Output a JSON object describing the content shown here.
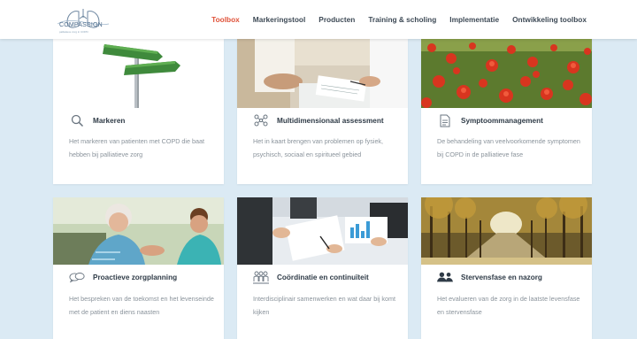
{
  "header": {
    "logo": {
      "title": "COMPASSION",
      "subtitle": "palliatieve zorg in COPD"
    },
    "nav": [
      {
        "label": "Toolbox",
        "active": true
      },
      {
        "label": "Markeringstool",
        "active": false
      },
      {
        "label": "Producten",
        "active": false
      },
      {
        "label": "Training & scholing",
        "active": false
      },
      {
        "label": "Implementatie",
        "active": false
      },
      {
        "label": "Ontwikkeling toolbox",
        "active": false
      }
    ]
  },
  "cards": [
    {
      "icon": "magnifier-icon",
      "title": "Markeren",
      "description": "Het markeren van patienten met COPD die baat hebben bij palliatieve zorg",
      "image": "signpost-image"
    },
    {
      "icon": "network-icon",
      "title": "Multidimensionaal assessment",
      "description": "Het in kaart brengen van problemen op fysiek, psychisch, sociaal en spiritueel gebied",
      "image": "consultation-image"
    },
    {
      "icon": "document-icon",
      "title": "Symptoommanagement",
      "description": "De behandeling van veelvoorkomende symptomen bij COPD in de palliatieve fase",
      "image": "poppy-field-image"
    },
    {
      "icon": "speech-bubbles-icon",
      "title": "Proactieve zorgplanning",
      "description": "Het bespreken van de toekomst en het levenseinde met de patient en diens naasten",
      "image": "caregiver-image"
    },
    {
      "icon": "team-icon",
      "title": "Coördinatie en continuïteit",
      "description": "Interdisciplinair samenwerken en wat daar bij komt kijken",
      "image": "meeting-image"
    },
    {
      "icon": "people-icon",
      "title": "Stervensfase en nazorg",
      "description": "Het evalueren van de zorg in de laatste levensfase en stervensfase",
      "image": "autumn-lane-image"
    }
  ],
  "colors": {
    "accent": "#e0533a",
    "page_background": "#dbeaf4",
    "text_dark": "#2f3b47",
    "text_muted": "#8a939b"
  }
}
